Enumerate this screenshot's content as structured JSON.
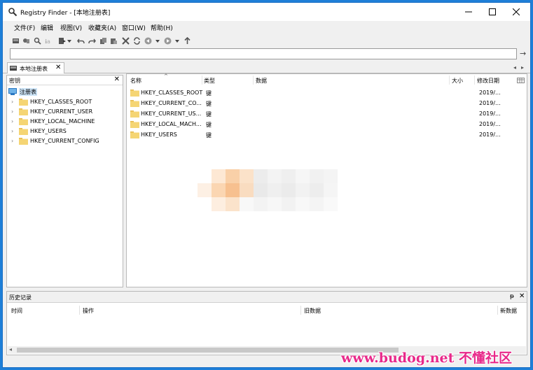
{
  "window": {
    "title": "Registry Finder - [本地注册表]"
  },
  "menu": [
    "文件(F)",
    "编辑",
    "视图(V)",
    "收藏夹(A)",
    "窗口(W)",
    "帮助(H)"
  ],
  "address": {
    "value": ""
  },
  "tab": {
    "label": "本地注册表"
  },
  "left_pane": {
    "title": "密钥",
    "root_label": "注册表",
    "nodes": [
      "HKEY_CLASSES_ROOT",
      "HKEY_CURRENT_USER",
      "HKEY_LOCAL_MACHINE",
      "HKEY_USERS",
      "HKEY_CURRENT_CONFIG"
    ]
  },
  "list": {
    "columns": {
      "name": "名称",
      "type": "类型",
      "data": "数据",
      "size": "大小",
      "modified": "修改日期"
    },
    "rows": [
      {
        "name": "HKEY_CLASSES_ROOT",
        "type": "键",
        "date": "2019/..."
      },
      {
        "name": "HKEY_CURRENT_CO...",
        "type": "键",
        "date": "2019/..."
      },
      {
        "name": "HKEY_CURRENT_US...",
        "type": "键",
        "date": "2019/..."
      },
      {
        "name": "HKEY_LOCAL_MACH...",
        "type": "键",
        "date": "2019/..."
      },
      {
        "name": "HKEY_USERS",
        "type": "键",
        "date": "2019/..."
      }
    ]
  },
  "history": {
    "title": "历史记录",
    "columns": {
      "time": "时间",
      "action": "操作",
      "old_data": "旧数据",
      "new_data": "新数据"
    }
  },
  "watermark": "www.budog.net 不懂社区",
  "colors": {
    "titlebar_border": "#1a6fc4",
    "folder": "#f5d574",
    "selection": "#cce4f7",
    "watermark": "#e8298a"
  }
}
